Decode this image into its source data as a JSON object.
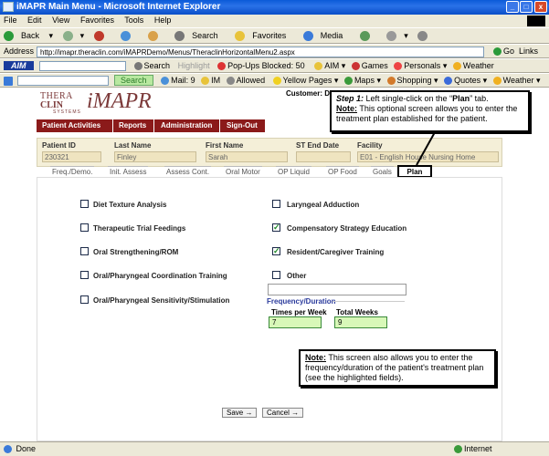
{
  "window": {
    "title": "iMAPR Main Menu - Microsoft Internet Explorer"
  },
  "menubar": [
    "File",
    "Edit",
    "View",
    "Favorites",
    "Tools",
    "Help"
  ],
  "toolbar": {
    "back": "Back",
    "search": "Search",
    "favorites": "Favorites",
    "media": "Media"
  },
  "address": {
    "label": "Address",
    "url": "http://imapr.theraclin.com/iMAPRDemo/Menus/TheraclinHorizontalMenu2.aspx",
    "go": "Go",
    "links": "Links"
  },
  "aimbar": {
    "aim_logo": "AIM",
    "search": "Search",
    "highlight": "Highlight",
    "popups": "Pop-Ups Blocked: 50",
    "aim": "AIM",
    "games": "Games",
    "personals": "Personals",
    "weather": "Weather"
  },
  "searchbar": {
    "search_btn": "Search",
    "mail": "Mail: 9",
    "im": "IM",
    "allowed": "Allowed",
    "yellow_pages": "Yellow Pages",
    "maps": "Maps",
    "shopping": "Shopping",
    "quotes": "Quotes",
    "weather": "Weather"
  },
  "app": {
    "logo_line1": "THERA",
    "logo_line2": "CLIN",
    "logo_sub": "SYSTEMS",
    "logo_name": "iMAPR",
    "customer_label": "Customer: D",
    "nav": [
      "Patient Activities",
      "Reports",
      "Administration",
      "Sign-Out"
    ]
  },
  "patient": {
    "id_label": "Patient ID",
    "id": "230321",
    "last_label": "Last Name",
    "last": "Finley",
    "first_label": "First Name",
    "first": "Sarah",
    "st_label": "ST End Date",
    "st": "",
    "facility_label": "Facility",
    "facility": "E01 - English House Nursing Home"
  },
  "tabs": [
    "Freq./Demo.",
    "Init. Assess",
    "Assess Cont.",
    "Oral Motor",
    "OP Liquid",
    "OP Food",
    "Goals",
    "Plan"
  ],
  "plan": {
    "left": [
      {
        "label": "Diet Texture Analysis",
        "checked": false
      },
      {
        "label": "Therapeutic Trial Feedings",
        "checked": false
      },
      {
        "label": "Oral Strengthening/ROM",
        "checked": false
      },
      {
        "label": "Oral/Pharyngeal Coordination Training",
        "checked": false
      },
      {
        "label": "Oral/Pharyngeal Sensitivity/Stimulation",
        "checked": false
      }
    ],
    "right": [
      {
        "label": "Laryngeal Adduction",
        "checked": false
      },
      {
        "label": "Compensatory Strategy Education",
        "checked": true
      },
      {
        "label": "Resident/Caregiver Training",
        "checked": true
      },
      {
        "label": "Other",
        "checked": false
      }
    ],
    "other_value": "",
    "freq_title": "Frequency/Duration",
    "times_label": "Times per Week",
    "times": "7",
    "weeks_label": "Total Weeks",
    "weeks": "9",
    "save": "Save",
    "cancel": "Cancel"
  },
  "callouts": {
    "step_label": "Step 1:",
    "step_text": " Left single-click on the “",
    "step_bold": "Plan",
    "step_end": "” tab.",
    "note_label": "Note:",
    "note_text": " This optional screen allows you to enter the treatment plan established for the patient.",
    "note2_label": "Note:",
    "note2_text": " This screen also allows you to enter the frequency/duration of the patient's treatment plan (see the highlighted fields)."
  },
  "status": {
    "done": "Done",
    "zone": "Internet"
  }
}
